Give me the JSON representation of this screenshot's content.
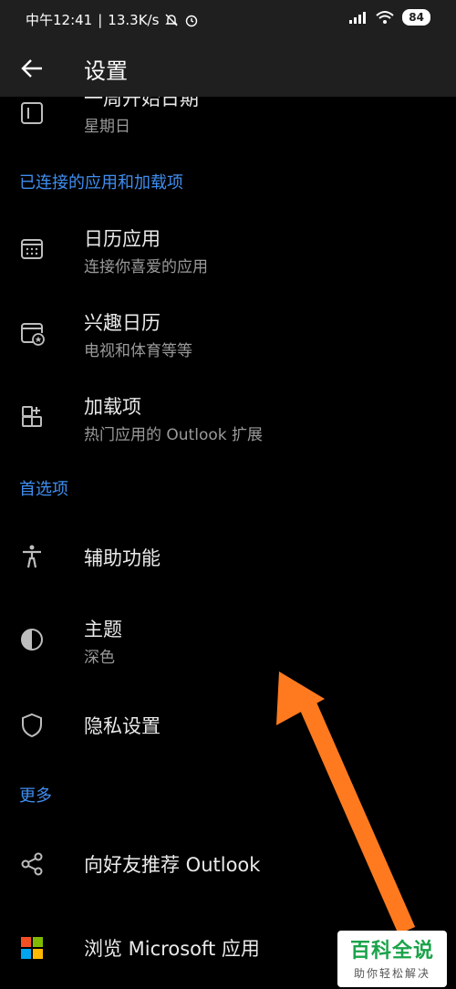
{
  "status_bar": {
    "time": "中午12:41",
    "net_speed": "13.3K/s",
    "battery": "84"
  },
  "app_bar": {
    "title": "设置"
  },
  "rows": {
    "week_start": {
      "title": "一周开始日期",
      "subtitle": "星期日"
    },
    "calendar_apps": {
      "title": "日历应用",
      "subtitle": "连接你喜爱的应用"
    },
    "interesting_calendars": {
      "title": "兴趣日历",
      "subtitle": "电视和体育等等"
    },
    "addins": {
      "title": "加载项",
      "subtitle": "热门应用的 Outlook 扩展"
    },
    "accessibility": {
      "title": "辅助功能"
    },
    "theme": {
      "title": "主题",
      "subtitle": "深色"
    },
    "privacy": {
      "title": "隐私设置"
    },
    "recommend": {
      "title": "向好友推荐 Outlook"
    },
    "browse_ms": {
      "title": "浏览 Microsoft 应用"
    }
  },
  "sections": {
    "connected": "已连接的应用和加载项",
    "preferences": "首选项",
    "more": "更多"
  },
  "watermark": {
    "main": "百科全说",
    "sub": "助你轻松解决"
  },
  "colors": {
    "accent": "#3f8ef0",
    "arrow": "#ff7a1f",
    "background": "#000000"
  }
}
